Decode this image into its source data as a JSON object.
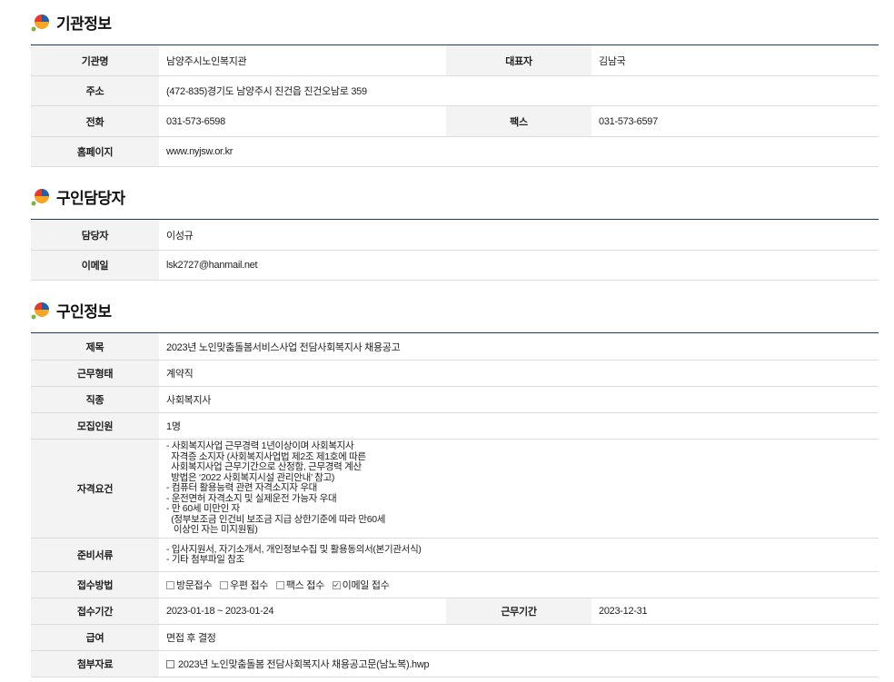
{
  "sections": {
    "org": {
      "title": "기관정보",
      "labels": {
        "name": "기관명",
        "rep": "대표자",
        "addr": "주소",
        "tel": "전화",
        "fax": "팩스",
        "homepage": "홈페이지"
      },
      "values": {
        "name": "남양주시노인복지관",
        "rep": "김남국",
        "addr": "(472-835)경기도 남양주시 진건읍 진건오남로 359",
        "tel": "031-573-6598",
        "fax": "031-573-6597",
        "homepage": "www.nyjsw.or.kr"
      }
    },
    "contact": {
      "title": "구인담당자",
      "labels": {
        "person": "담당자",
        "email": "이메일"
      },
      "values": {
        "person": "이성규",
        "email": "lsk2727@hanmail.net"
      }
    },
    "job": {
      "title": "구인정보",
      "labels": {
        "subject": "제목",
        "type": "근무형태",
        "category": "직종",
        "count": "모집인원",
        "qual": "자격요건",
        "docs": "준비서류",
        "method": "접수방법",
        "period": "접수기간",
        "workperiod": "근무기간",
        "salary": "급여",
        "attach": "첨부자료"
      },
      "values": {
        "subject": "2023년 노인맞춤돌봄서비스사업 전담사회복지사 채용공고",
        "type": "계약직",
        "category": "사회복지사",
        "count": "1명",
        "qual_lines": [
          "- 사회복지사업 근무경력 1년이상이며 사회복지사",
          "  자격증 소지자 (사회복지사업법 제2조 제1호에 따른",
          "  사회복지사업 근무기간으로 산정함, 근무경력 계산",
          "  방법은 ‘2022 사회복지시설 관리안내’ 참고)",
          "- 컴퓨터 활용능력 관련 자격소지자 우대",
          "- 운전면허 자격소지 및 실제운전 가능자 우대",
          "- 만 60세 미만인 자",
          "  (정부보조금 인건비 보조금 지급 상한기준에 따라 만60세",
          "   이상인 자는 미지원됨)"
        ],
        "docs_lines": [
          "- 입사지원서, 자기소개서, 개인정보수집 및 활용동의서(본기관서식)",
          "- 기타 첨부파일 참조"
        ],
        "methods": [
          {
            "label": "방문접수",
            "checked": false
          },
          {
            "label": "우편 접수",
            "checked": false
          },
          {
            "label": "팩스 접수",
            "checked": false
          },
          {
            "label": "이메일 접수",
            "checked": true
          }
        ],
        "period": "2023-01-18 ~ 2023-01-24",
        "workperiod": "2023-12-31",
        "salary": "면접 후 결정",
        "attach": "2023년 노인맞춤돌봄 전담사회복지사 채용공고문(남노복).hwp"
      }
    }
  },
  "colors": {
    "accent_line": "#1f3c5c",
    "header_bg": "#f3f3f3",
    "border": "#dcdcdc"
  },
  "icons": {
    "section_logo": "section-logo-icon",
    "attach": "file-icon",
    "checkbox": "checkbox-icon"
  }
}
